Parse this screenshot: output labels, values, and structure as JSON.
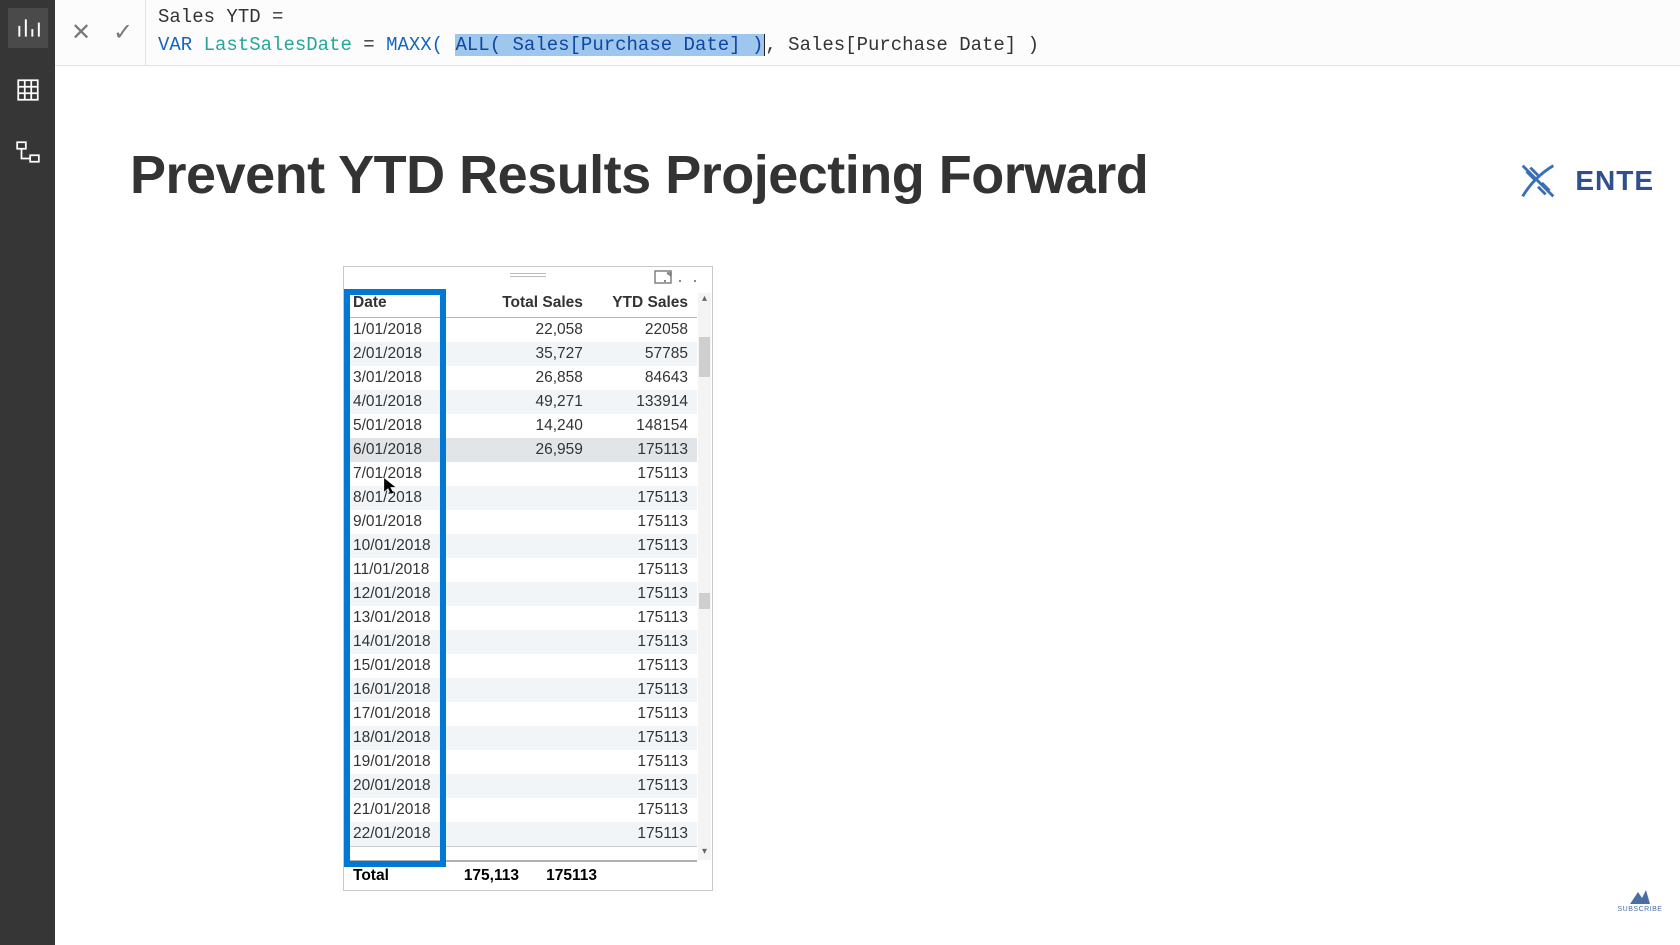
{
  "nav": {
    "items": [
      "report-view",
      "data-view",
      "model-view"
    ]
  },
  "formula": {
    "line1_name": "Sales YTD",
    "line1_op": "=",
    "var_kw": "VAR",
    "var_name": "LastSalesDate",
    "eq": "=",
    "fn_maxx": "MAXX(",
    "sel_all": "ALL(",
    "sel_col": " Sales[Purchase Date] ",
    "sel_close": ")",
    "comma": ",",
    "arg2": " Sales[Purchase Date] ",
    "close": ")"
  },
  "page": {
    "title": "Prevent YTD Results Projecting Forward",
    "brand_text": "ENTE"
  },
  "table": {
    "headers": [
      "Date",
      "Total Sales",
      "YTD Sales"
    ],
    "rows": [
      {
        "date": "1/01/2018",
        "total": "22,058",
        "ytd": "22058"
      },
      {
        "date": "2/01/2018",
        "total": "35,727",
        "ytd": "57785"
      },
      {
        "date": "3/01/2018",
        "total": "26,858",
        "ytd": "84643"
      },
      {
        "date": "4/01/2018",
        "total": "49,271",
        "ytd": "133914"
      },
      {
        "date": "5/01/2018",
        "total": "14,240",
        "ytd": "148154"
      },
      {
        "date": "6/01/2018",
        "total": "26,959",
        "ytd": "175113"
      },
      {
        "date": "7/01/2018",
        "total": "",
        "ytd": "175113"
      },
      {
        "date": "8/01/2018",
        "total": "",
        "ytd": "175113"
      },
      {
        "date": "9/01/2018",
        "total": "",
        "ytd": "175113"
      },
      {
        "date": "10/01/2018",
        "total": "",
        "ytd": "175113"
      },
      {
        "date": "11/01/2018",
        "total": "",
        "ytd": "175113"
      },
      {
        "date": "12/01/2018",
        "total": "",
        "ytd": "175113"
      },
      {
        "date": "13/01/2018",
        "total": "",
        "ytd": "175113"
      },
      {
        "date": "14/01/2018",
        "total": "",
        "ytd": "175113"
      },
      {
        "date": "15/01/2018",
        "total": "",
        "ytd": "175113"
      },
      {
        "date": "16/01/2018",
        "total": "",
        "ytd": "175113"
      },
      {
        "date": "17/01/2018",
        "total": "",
        "ytd": "175113"
      },
      {
        "date": "18/01/2018",
        "total": "",
        "ytd": "175113"
      },
      {
        "date": "19/01/2018",
        "total": "",
        "ytd": "175113"
      },
      {
        "date": "20/01/2018",
        "total": "",
        "ytd": "175113"
      },
      {
        "date": "21/01/2018",
        "total": "",
        "ytd": "175113"
      },
      {
        "date": "22/01/2018",
        "total": "",
        "ytd": "175113"
      }
    ],
    "total_label": "Total",
    "total_total": "175,113",
    "total_ytd": "175113",
    "hover_row_index": 5
  },
  "subscribe": {
    "label": "SUBSCRIBE"
  }
}
